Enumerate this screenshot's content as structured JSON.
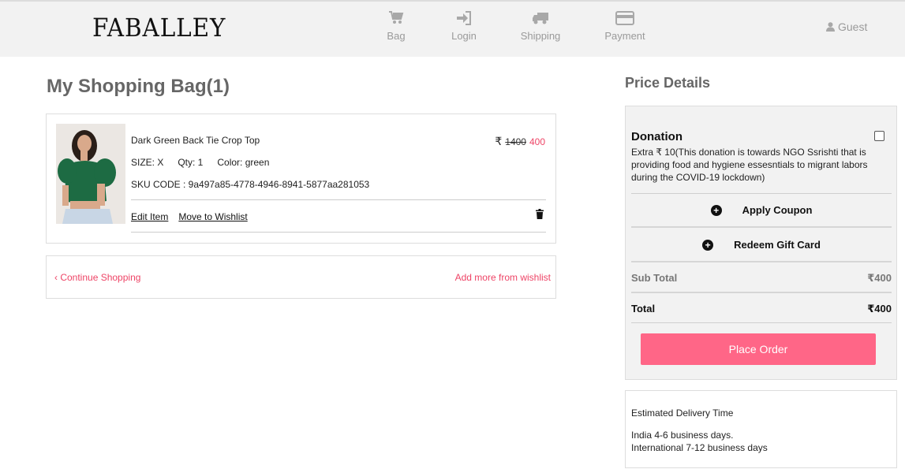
{
  "brand": "FABALLEY",
  "steps": [
    {
      "label": "Bag",
      "icon": "cart-icon"
    },
    {
      "label": "Login",
      "icon": "sign-in-icon"
    },
    {
      "label": "Shipping",
      "icon": "truck-icon"
    },
    {
      "label": "Payment",
      "icon": "credit-card-icon"
    }
  ],
  "user": {
    "label": "Guest",
    "icon": "user-icon"
  },
  "bag": {
    "title": "My Shopping Bag(1)",
    "item": {
      "name": "Dark Green Back Tie Crop Top",
      "currency": "₹",
      "old_price": "1400",
      "price": "400",
      "size": "SIZE: X",
      "qty": "Qty: 1",
      "color": "Color: green",
      "sku": "SKU CODE : 9a497a85-4778-4946-8941-5877aa281053",
      "edit_label": "Edit Item",
      "wishlist_label": "Move to Wishlist",
      "delete_icon": "trash-icon"
    },
    "continue_label": "‹ Continue Shopping",
    "wishlist_more_label": "Add more from wishlist"
  },
  "price_details": {
    "title": "Price Details",
    "donation_title": "Donation",
    "donation_text": "Extra ₹ 10(This donation is towards NGO Ssrishti that is providing food and hygiene essesntials to migrant labors during the COVID-19 lockdown)",
    "apply_coupon": "Apply Coupon",
    "redeem_gift": "Redeem Gift Card",
    "subtotal_label": "Sub Total",
    "subtotal_value": "₹400",
    "total_label": "Total",
    "total_value": "₹400",
    "place_order": "Place Order"
  },
  "delivery": {
    "title": "Estimated Delivery Time",
    "india": "India 4-6 business days.",
    "international": "International 7-12 business days"
  },
  "colors": {
    "accent": "#ff6687",
    "sale_red": "#ee4466",
    "header_bg": "#f2f2f2",
    "muted": "#9a9a9a"
  }
}
